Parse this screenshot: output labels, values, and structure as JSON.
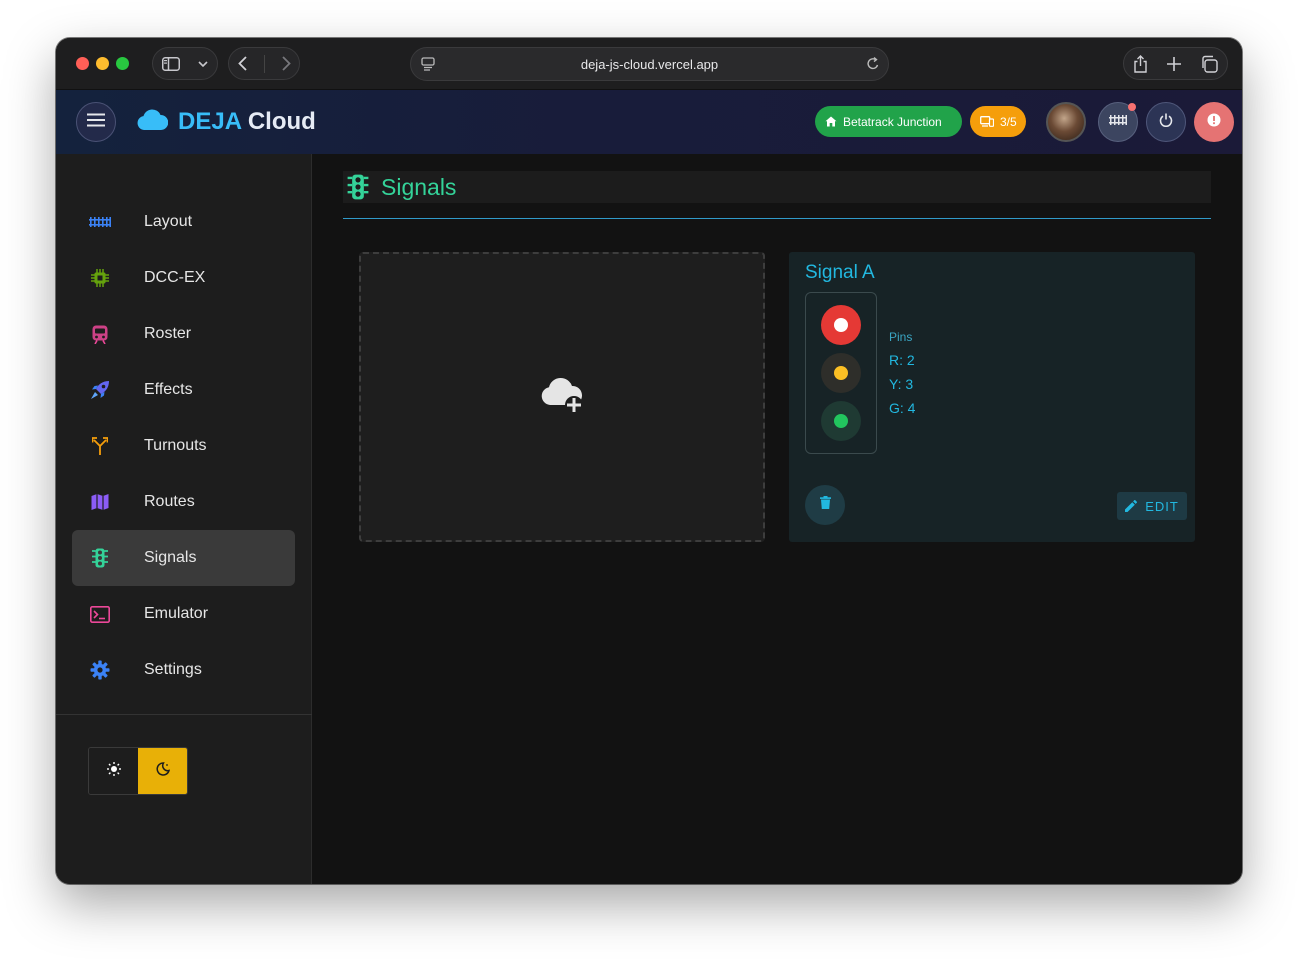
{
  "browser": {
    "url": "deja-js-cloud.vercel.app"
  },
  "header": {
    "brand_deja": "DEJA",
    "brand_cloud": "Cloud",
    "layout_chip": "Betatrack Junction",
    "devices_chip": "3/5"
  },
  "sidebar": {
    "items": [
      {
        "label": "Layout",
        "icon": "track-icon",
        "color": "#3b82f6"
      },
      {
        "label": "DCC-EX",
        "icon": "chip-icon",
        "color": "#65a30d"
      },
      {
        "label": "Roster",
        "icon": "train-icon",
        "color": "#f472b6"
      },
      {
        "label": "Effects",
        "icon": "rocket-icon",
        "color": "#6366f1"
      },
      {
        "label": "Turnouts",
        "icon": "turnout-icon",
        "color": "#f59e0b"
      },
      {
        "label": "Routes",
        "icon": "map-icon",
        "color": "#8b5cf6"
      },
      {
        "label": "Signals",
        "icon": "traffic-light-icon",
        "color": "#34d399",
        "active": true
      },
      {
        "label": "Emulator",
        "icon": "terminal-icon",
        "color": "#ec4899"
      },
      {
        "label": "Settings",
        "icon": "cog-icon",
        "color": "#3b82f6"
      }
    ]
  },
  "main": {
    "title": "Signals",
    "signal": {
      "name": "Signal A",
      "pins_label": "Pins",
      "pins": [
        "R: 2",
        "Y: 3",
        "G: 4"
      ],
      "edit_label": "EDIT"
    }
  },
  "colors": {
    "accent": "#22b8e0",
    "signals_green": "#34d399",
    "lamp_red": "#e53935",
    "lamp_yellow": "#fbbf24",
    "lamp_green": "#22c55e",
    "theme_dark_toggle": "#e8b007"
  }
}
